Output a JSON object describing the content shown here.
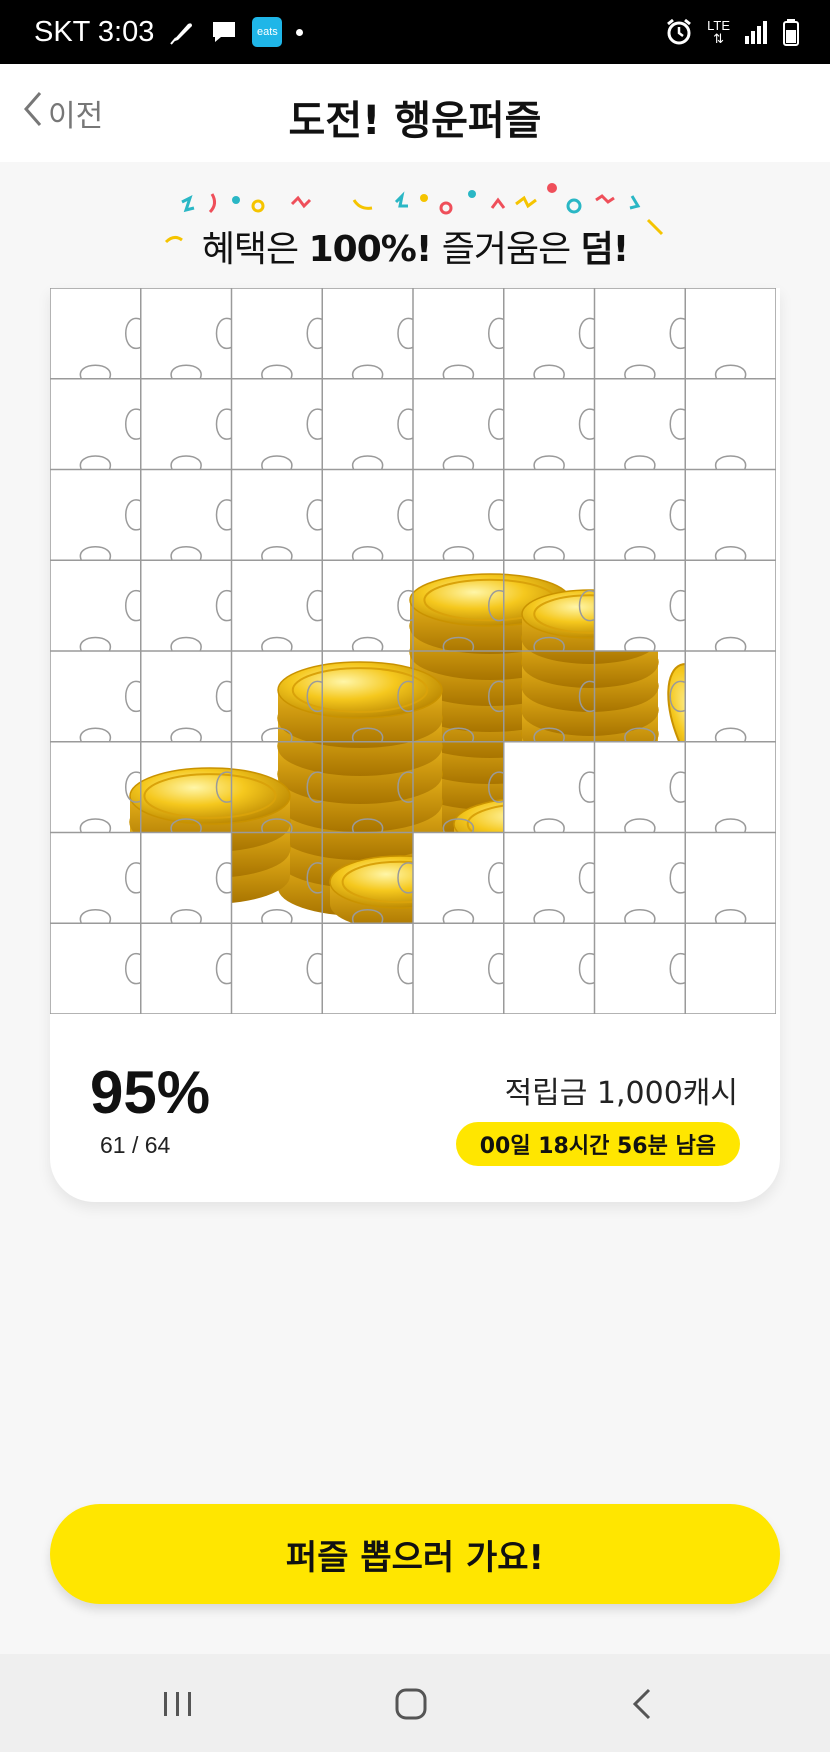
{
  "status_bar": {
    "carrier_time": "SKT 3:03",
    "eats_label": "eats",
    "network": "LTE"
  },
  "header": {
    "back_label": "이전",
    "title": "도전! 행운퍼즐"
  },
  "banner": {
    "part1": "혜택은 ",
    "part2": "100%!",
    "part3": " 즐거움은 ",
    "part4": "덤!"
  },
  "puzzle": {
    "grid_rows": 8,
    "grid_cols": 8,
    "image": "gold coin stacks"
  },
  "progress": {
    "percent": "95%",
    "count": "61 / 64",
    "filled": 61,
    "total": 64
  },
  "reward": {
    "label": "적립금 1,000캐시"
  },
  "timer": {
    "remaining": "00일 18시간 56분 남음"
  },
  "cta": {
    "label": "퍼즐 뽑으러 가요!"
  },
  "colors": {
    "accent": "#ffe600",
    "status_bg": "#000000"
  }
}
